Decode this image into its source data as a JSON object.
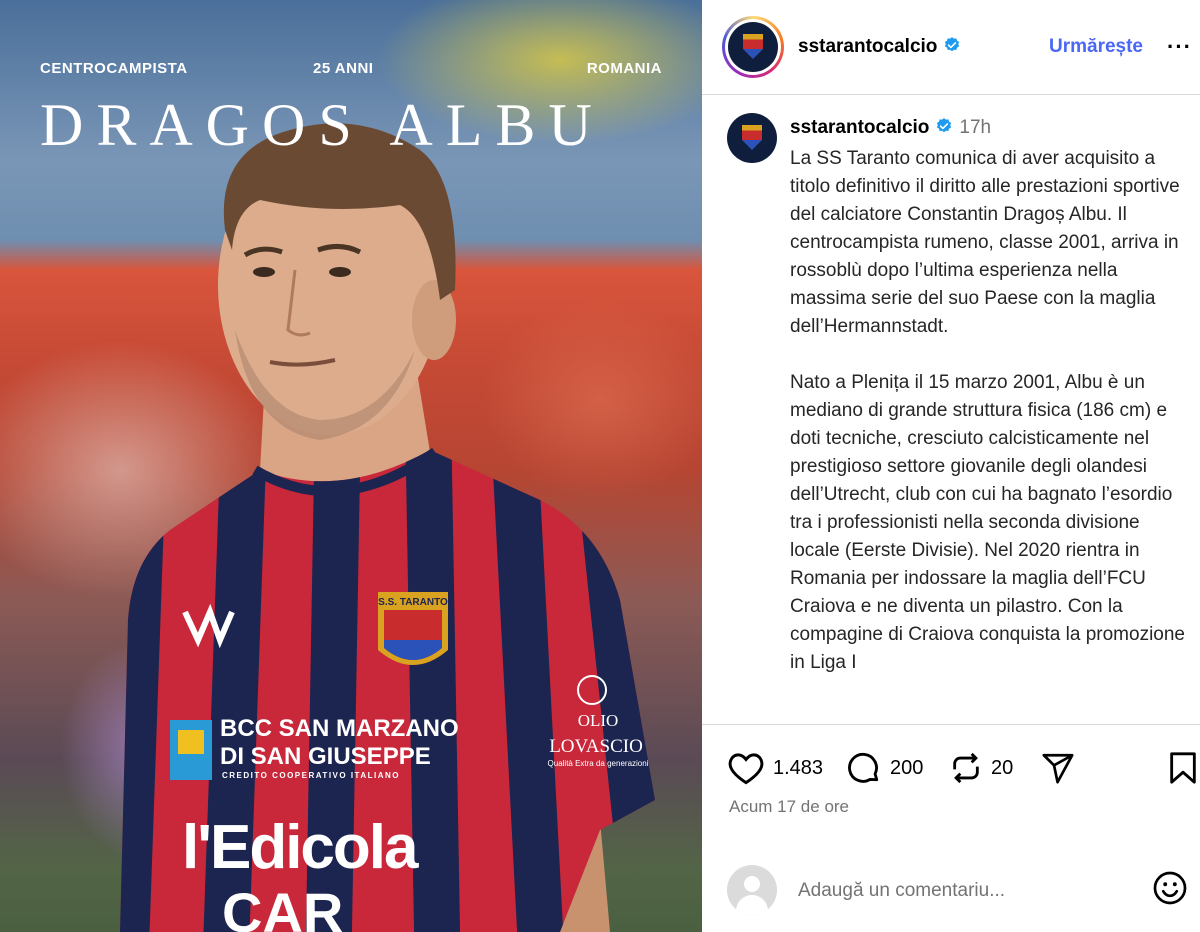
{
  "post": {
    "username": "sstarantocalcio",
    "follow_label": "Urmărește",
    "more_label": "···",
    "time_short": "17h",
    "caption_paragraphs": [
      "La SS Taranto comunica di aver acquisito a titolo definitivo il diritto alle prestazioni sportive del calciatore Constantin Dragoș Albu. Il centrocampista rumeno, classe 2001, arriva in rossoblù dopo l’ultima esperienza nella massima serie del suo Paese con la maglia dell’Hermannstadt.",
      "Nato a Plenița il 15 marzo 2001, Albu è un mediano di grande struttura fisica (186 cm) e doti tecniche, cresciuto calcisticamente nel prestigioso settore giovanile degli olandesi dell’Utrecht, club con cui ha bagnato l’esordio tra i professionisti nella seconda divisione locale (Eerste Divisie). Nel 2020 rientra in Romania per indossare la maglia dell’FCU Craiova e ne diventa un pilastro. Con la compagine di Craiova conquista la promozione in Liga I"
    ],
    "likes": "1.483",
    "comments": "200",
    "reposts": "20",
    "time_ago": "Acum 17 de ore",
    "comment_placeholder": "Adaugă un comentariu..."
  },
  "image": {
    "role": "CENTROCAMPISTA",
    "age": "25 ANNI",
    "country": "ROMANIA",
    "player_name": "DRAGOS ALBU",
    "shirt_sponsor_1": "BCC SAN MARZANO",
    "shirt_sponsor_2": "DI SAN GIUSEPPE",
    "shirt_sponsor_3": "CREDITO COOPERATIVO ITALIANO",
    "shirt_main_sponsor": "l'Edicola",
    "shirt_bottom_sponsor": "CAR",
    "crest_text": "S.S. TARANTO",
    "sleeve_sponsor_1": "OLIO",
    "sleeve_sponsor_2": "LOVASCIO",
    "sleeve_sponsor_3": "Qualità Extra da generazioni"
  },
  "colors": {
    "follow": "#4a67f5",
    "muted": "#737373",
    "shirt_red": "#c8283a",
    "shirt_navy": "#1c2450"
  },
  "icons": [
    "heart-icon",
    "comment-icon",
    "repost-icon",
    "share-icon",
    "bookmark-icon",
    "verified-icon",
    "emoji-icon",
    "more-icon"
  ]
}
